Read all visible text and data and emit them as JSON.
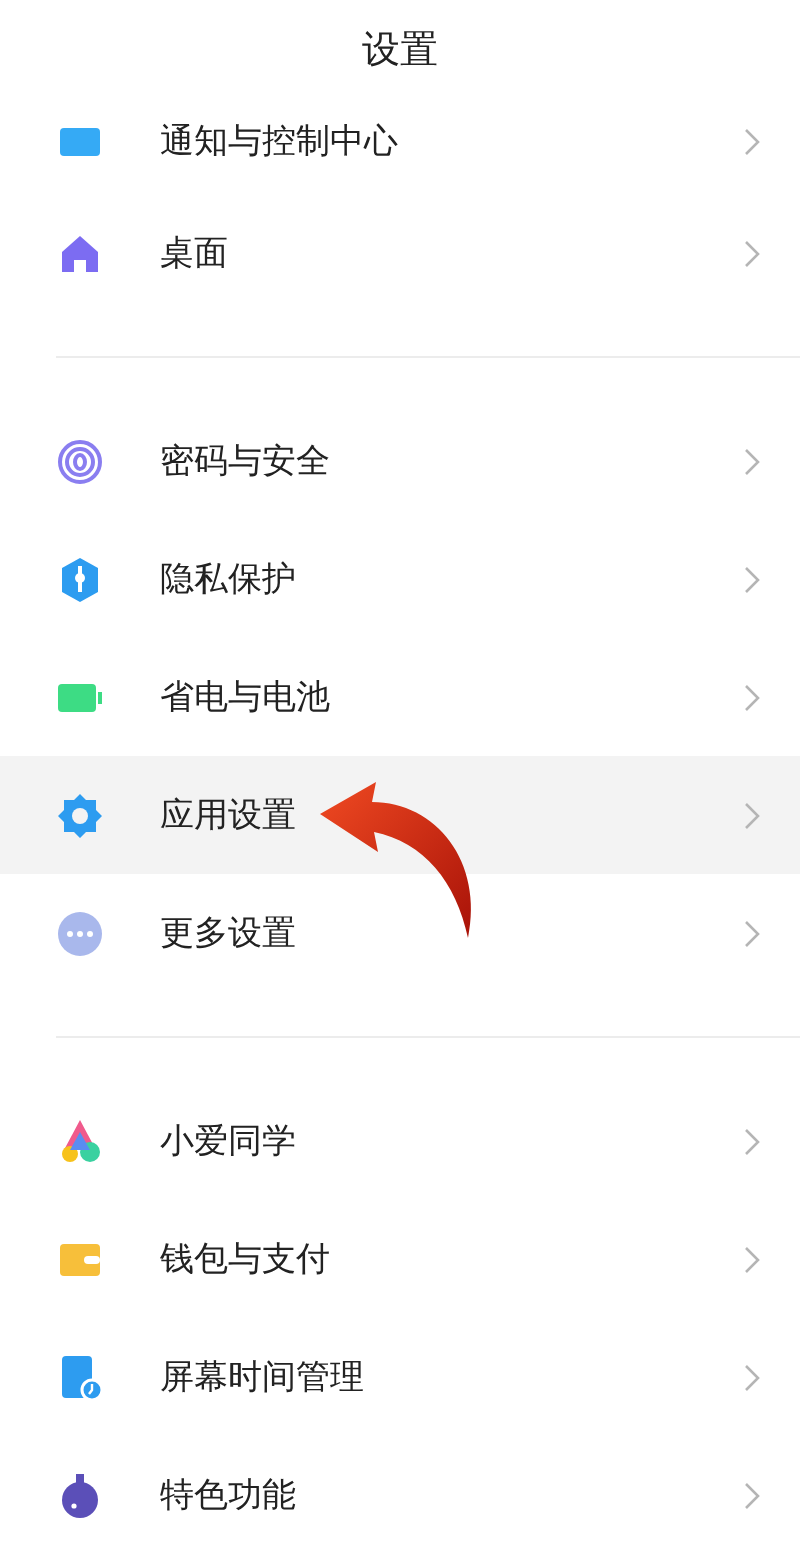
{
  "header": {
    "title": "设置"
  },
  "groups": [
    {
      "items": [
        {
          "label": "通知与控制中心",
          "selected": false
        },
        {
          "label": "桌面",
          "selected": false
        }
      ]
    },
    {
      "items": [
        {
          "label": "密码与安全",
          "selected": false
        },
        {
          "label": "隐私保护",
          "selected": false
        },
        {
          "label": "省电与电池",
          "selected": false
        },
        {
          "label": "应用设置",
          "selected": true
        },
        {
          "label": "更多设置",
          "selected": false
        }
      ]
    },
    {
      "items": [
        {
          "label": "小爱同学",
          "selected": false
        },
        {
          "label": "钱包与支付",
          "selected": false
        },
        {
          "label": "屏幕时间管理",
          "selected": false
        },
        {
          "label": "特色功能",
          "selected": false
        }
      ]
    }
  ]
}
